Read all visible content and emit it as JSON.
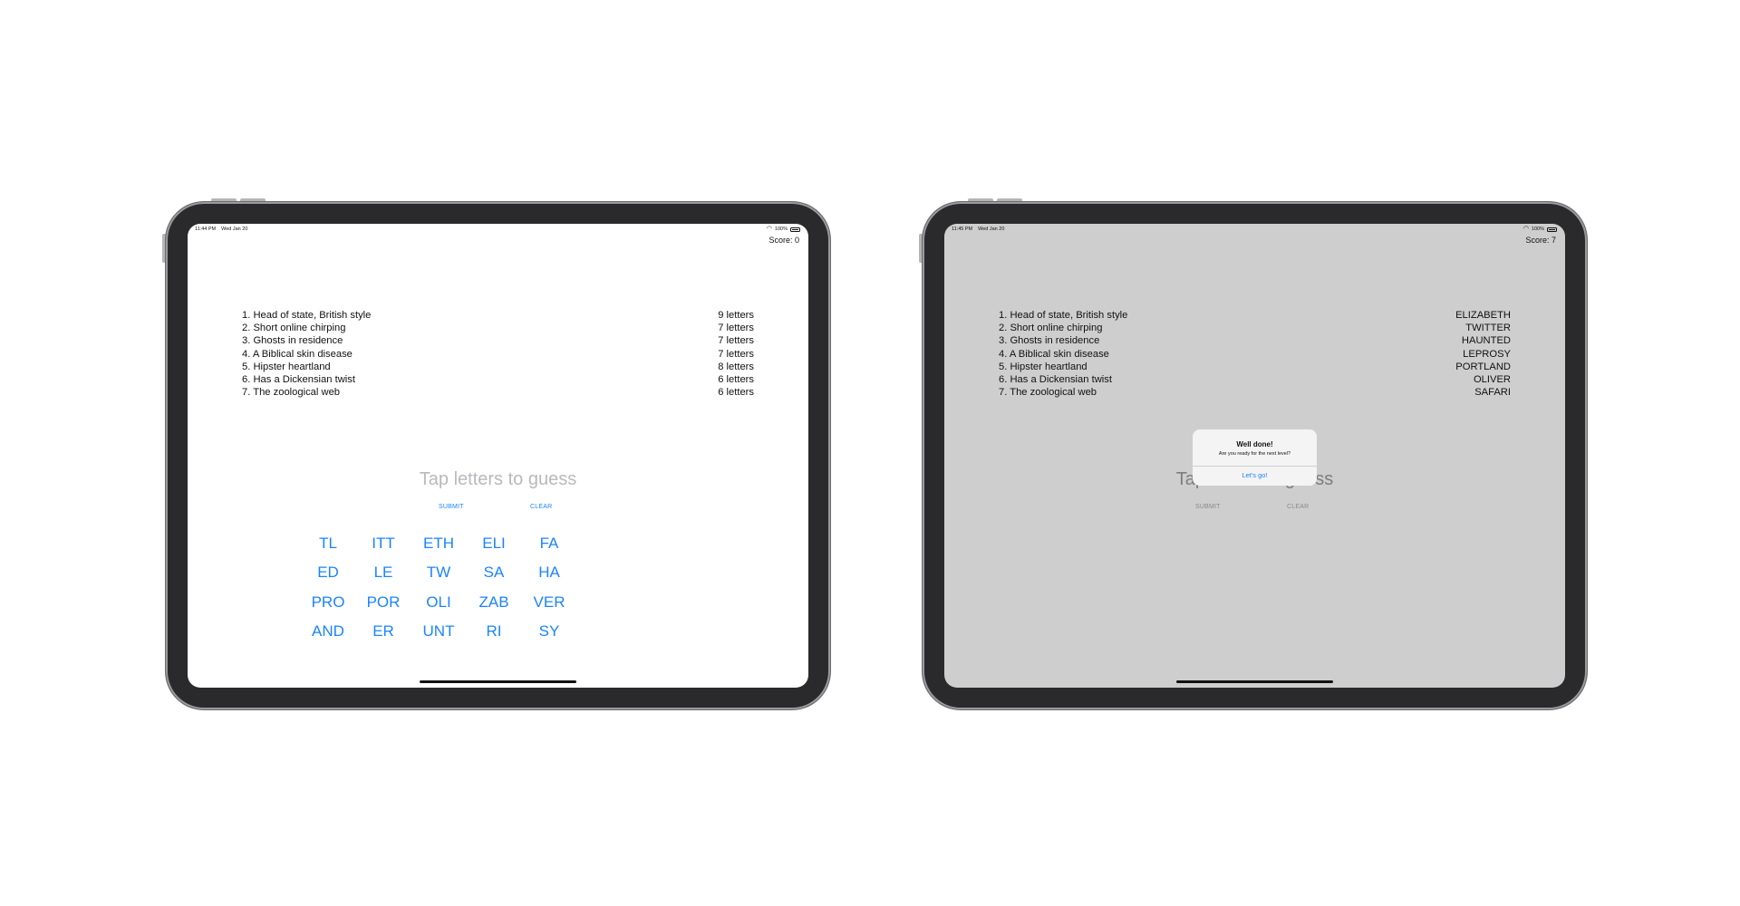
{
  "left_device": {
    "status": {
      "time": "11:44 PM",
      "date": "Wed Jan 20",
      "battery": "100%"
    },
    "score": "Score: 0",
    "clues": [
      "1. Head of state, British style",
      "2. Short online chirping",
      "3. Ghosts in residence",
      "4. A Biblical skin disease",
      "5. Hipster heartland",
      "6. Has a Dickensian twist",
      "7. The zoological web"
    ],
    "answers": [
      "9 letters",
      "7 letters",
      "7 letters",
      "7 letters",
      "8 letters",
      "6 letters",
      "6 letters"
    ],
    "guess_placeholder": "Tap letters to guess",
    "submit_label": "SUBMIT",
    "clear_label": "CLEAR",
    "tiles": [
      [
        "TL",
        "ITT",
        "ETH",
        "ELI",
        "FA"
      ],
      [
        "ED",
        "LE",
        "TW",
        "SA",
        "HA"
      ],
      [
        "PRO",
        "POR",
        "OLI",
        "ZAB",
        "VER"
      ],
      [
        "AND",
        "ER",
        "UNT",
        "RI",
        "SY"
      ]
    ]
  },
  "right_device": {
    "status": {
      "time": "11:45 PM",
      "date": "Wed Jan 20",
      "battery": "100%"
    },
    "score": "Score: 7",
    "clues": [
      "1. Head of state, British style",
      "2. Short online chirping",
      "3. Ghosts in residence",
      "4. A Biblical skin disease",
      "5. Hipster heartland",
      "6. Has a Dickensian twist",
      "7. The zoological web"
    ],
    "answers": [
      "ELIZABETH",
      "TWITTER",
      "HAUNTED",
      "LEPROSY",
      "PORTLAND",
      "OLIVER",
      "SAFARI"
    ],
    "guess_placeholder": "Tap letters to guess",
    "submit_label": "SUBMIT",
    "clear_label": "CLEAR",
    "alert": {
      "title": "Well done!",
      "message": "Are you ready for the next level?",
      "button": "Let's go!"
    }
  },
  "colors": {
    "accent": "#1a84ff",
    "dimmed_background": "#cecece",
    "bezel": "#2a2a2c"
  }
}
